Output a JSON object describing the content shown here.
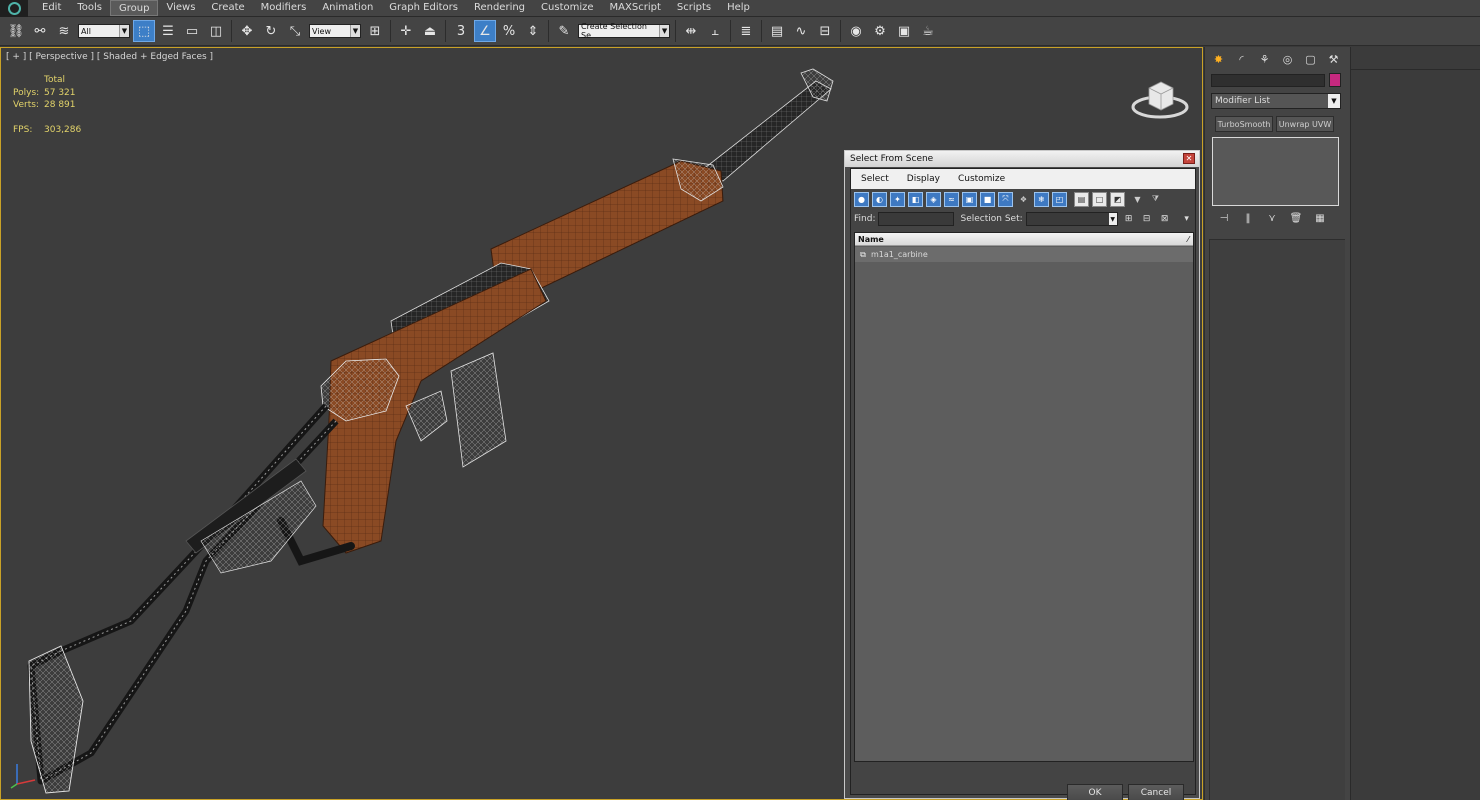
{
  "menu": {
    "items": [
      "Edit",
      "Tools",
      "Group",
      "Views",
      "Create",
      "Modifiers",
      "Animation",
      "Graph Editors",
      "Rendering",
      "Customize",
      "MAXScript",
      "Scripts",
      "Help"
    ],
    "active": "Group"
  },
  "toolbar": {
    "selection_filter": "All",
    "reference_coord": "View",
    "named_selection": "Create Selection Se",
    "snap_label": "3"
  },
  "viewport": {
    "label": "[ + ] [ Perspective ] [ Shaded + Edged Faces ]",
    "stats": {
      "total_label": "Total",
      "polys_label": "Polys:",
      "polys_value": "57 321",
      "verts_label": "Verts:",
      "verts_value": "28 891",
      "fps_label": "FPS:",
      "fps_value": "303,286"
    },
    "colors": {
      "wood": "#8a4a24",
      "metal": "#2b2b2b",
      "wire": "#d0d0d0",
      "selection_border": "#c9a227"
    }
  },
  "command_panel": {
    "modifier_list": "Modifier List",
    "buttons": [
      "TurboSmooth",
      "Unwrap UVW"
    ],
    "object_color": "#c6297f"
  },
  "dialog": {
    "title": "Select From Scene",
    "menu": [
      "Select",
      "Display",
      "Customize"
    ],
    "find_label": "Find:",
    "selection_set_label": "Selection Set:",
    "column_name": "Name",
    "rows": [
      "m1a1_carbine"
    ],
    "ok_label": "OK",
    "cancel_label": "Cancel"
  }
}
